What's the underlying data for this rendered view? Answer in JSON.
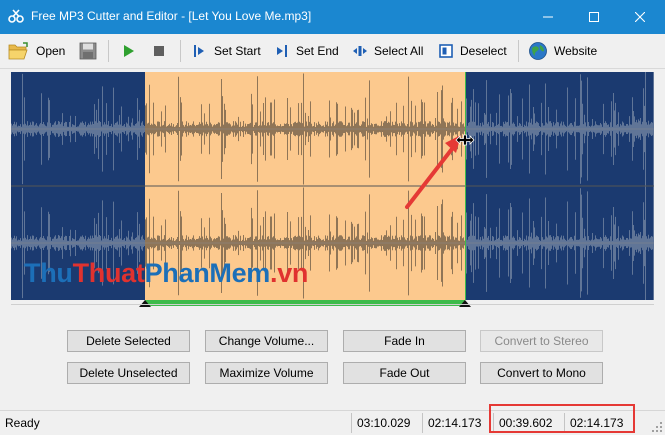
{
  "window": {
    "title": "Free MP3 Cutter and Editor - [Let You Love Me.mp3]",
    "controls": [
      "minimize",
      "maximize",
      "close"
    ]
  },
  "toolbar": {
    "open_label": "Open",
    "set_start_label": "Set Start",
    "set_end_label": "Set End",
    "select_all_label": "Select All",
    "deselect_label": "Deselect",
    "website_label": "Website"
  },
  "selection": {
    "start_fraction": 0.209,
    "end_fraction": 0.706,
    "waveform_color": "#1b3a70",
    "selection_color": "#fcc98e",
    "marker_color": "#3dbb4a"
  },
  "buttons": {
    "delete_selected": "Delete Selected",
    "change_volume": "Change Volume...",
    "fade_in": "Fade In",
    "convert_to_stereo": "Convert to Stereo",
    "delete_unselected": "Delete Unselected",
    "maximize_volume": "Maximize Volume",
    "fade_out": "Fade Out",
    "convert_to_mono": "Convert to Mono"
  },
  "status": {
    "state": "Ready",
    "total_length": "03:10.029",
    "current_position": "02:14.173",
    "selection_length": "00:39.602",
    "selection_end": "02:14.173"
  },
  "watermark": {
    "part1": "Thu",
    "part2": "Thuat",
    "part3": "PhanMem",
    "part4": ".vn"
  },
  "colors": {
    "titlebar": "#1b87d0",
    "highlight": "#e53935",
    "arrow": "#e53935"
  }
}
